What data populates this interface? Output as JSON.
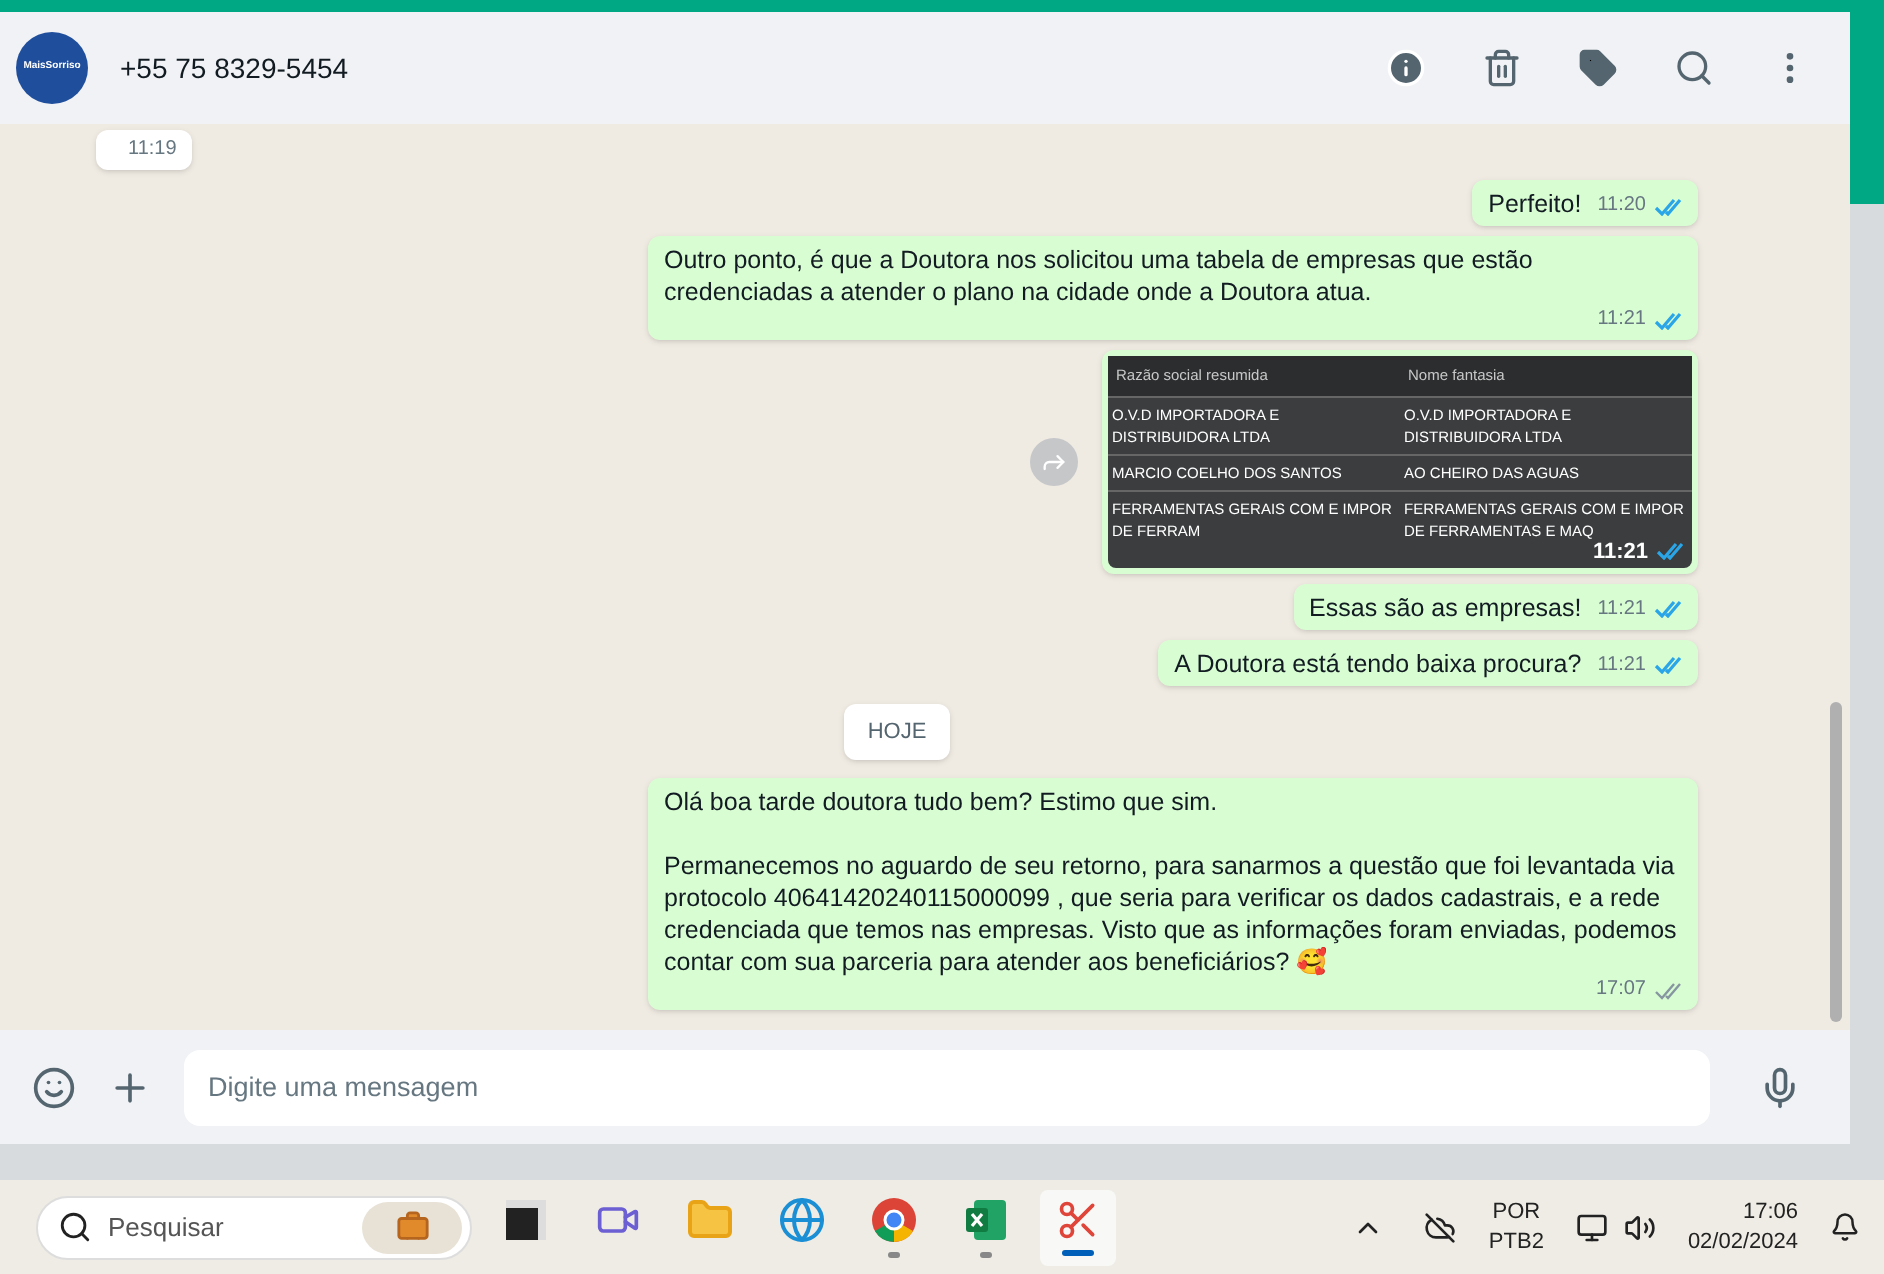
{
  "header": {
    "contact": "+55 75 8329-5454",
    "avatar_label": "MaisSorriso"
  },
  "messages": [
    {
      "kind": "text",
      "outgoing": false,
      "time": "11:19"
    },
    {
      "kind": "text",
      "outgoing": true,
      "text": "Perfeito!",
      "time": "11:20",
      "read": true
    },
    {
      "kind": "text",
      "outgoing": true,
      "text": "Outro ponto, é que a Doutora nos solicitou uma tabela de empresas que estão credenciadas a atender o plano na cidade onde a Doutora atua.",
      "time": "11:21",
      "read": true
    },
    {
      "kind": "image",
      "outgoing": true,
      "time": "11:21",
      "read": true,
      "table": {
        "columns": [
          "Razão social resumida",
          "Nome fantasia"
        ],
        "rows": [
          [
            "O.V.D IMPORTADORA E DISTRIBUIDORA LTDA",
            "O.V.D IMPORTADORA E DISTRIBUIDORA LTDA"
          ],
          [
            "MARCIO COELHO DOS SANTOS",
            "AO CHEIRO DAS AGUAS"
          ],
          [
            "FERRAMENTAS GERAIS COM E IMPOR DE FERRAM",
            "FERRAMENTAS GERAIS COM E IMPOR DE FERRAMENTAS E MAQ"
          ]
        ]
      }
    },
    {
      "kind": "text",
      "outgoing": true,
      "text": "Essas são as empresas!",
      "time": "11:21",
      "read": true
    },
    {
      "kind": "text",
      "outgoing": true,
      "text": "A Doutora está tendo baixa procura?",
      "time": "11:21",
      "read": true
    },
    {
      "kind": "date",
      "text": "HOJE"
    },
    {
      "kind": "text",
      "outgoing": true,
      "text": "Olá boa tarde doutora tudo bem? Estimo que sim.\n\nPermanecemos no aguardo de seu retorno, para sanarmos a questão que foi levantada via protocolo 40641420240115000099 , que seria para verificar os dados cadastrais, e a rede credenciada que temos nas empresas. Visto que as informações foram enviadas, podemos contar com sua parceria para atender aos beneficiários? 🥰",
      "time": "17:07",
      "read": false
    }
  ],
  "composer": {
    "placeholder": "Digite uma mensagem"
  },
  "taskbar": {
    "search_placeholder": "Pesquisar",
    "apps": [
      {
        "kind": "taskview",
        "running": false,
        "active": false
      },
      {
        "kind": "meet",
        "running": false,
        "active": false
      },
      {
        "kind": "folder",
        "running": false,
        "active": false
      },
      {
        "kind": "edge",
        "running": false,
        "active": false
      },
      {
        "kind": "chrome",
        "running": true,
        "active": false
      },
      {
        "kind": "excel",
        "running": true,
        "active": false
      },
      {
        "kind": "snip",
        "running": true,
        "active": true
      }
    ],
    "lang": "POR",
    "layout": "PTB2",
    "time": "17:06",
    "date": "02/02/2024"
  }
}
